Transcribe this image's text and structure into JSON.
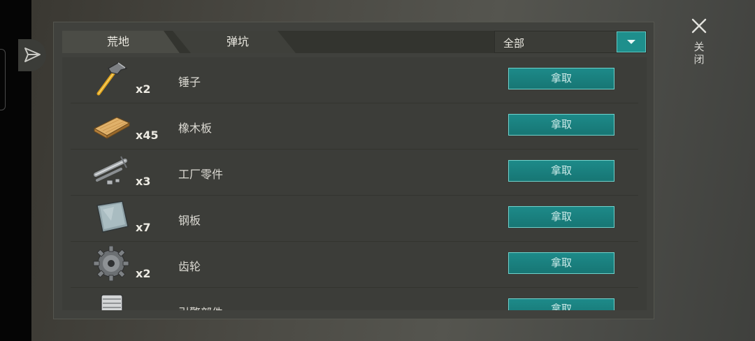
{
  "close": {
    "label": "关闭"
  },
  "tabs": [
    {
      "label": "荒地"
    },
    {
      "label": "弹坑"
    }
  ],
  "filter": {
    "value": "全部"
  },
  "items": [
    {
      "name": "锤子",
      "qty": "x2",
      "icon": "hammer-icon",
      "action": "拿取"
    },
    {
      "name": "橡木板",
      "qty": "x45",
      "icon": "wood-plank-icon",
      "action": "拿取"
    },
    {
      "name": "工厂零件",
      "qty": "x3",
      "icon": "factory-parts-icon",
      "action": "拿取"
    },
    {
      "name": "钢板",
      "qty": "x7",
      "icon": "steel-plate-icon",
      "action": "拿取"
    },
    {
      "name": "齿轮",
      "qty": "x2",
      "icon": "gear-icon",
      "action": "拿取"
    },
    {
      "name": "引擎部件",
      "qty": "",
      "icon": "engine-part-icon",
      "action": "拿取"
    }
  ],
  "colors": {
    "accent": "#1e8f8c",
    "accent_border": "#6fd2cc",
    "panel": "#40413d"
  }
}
